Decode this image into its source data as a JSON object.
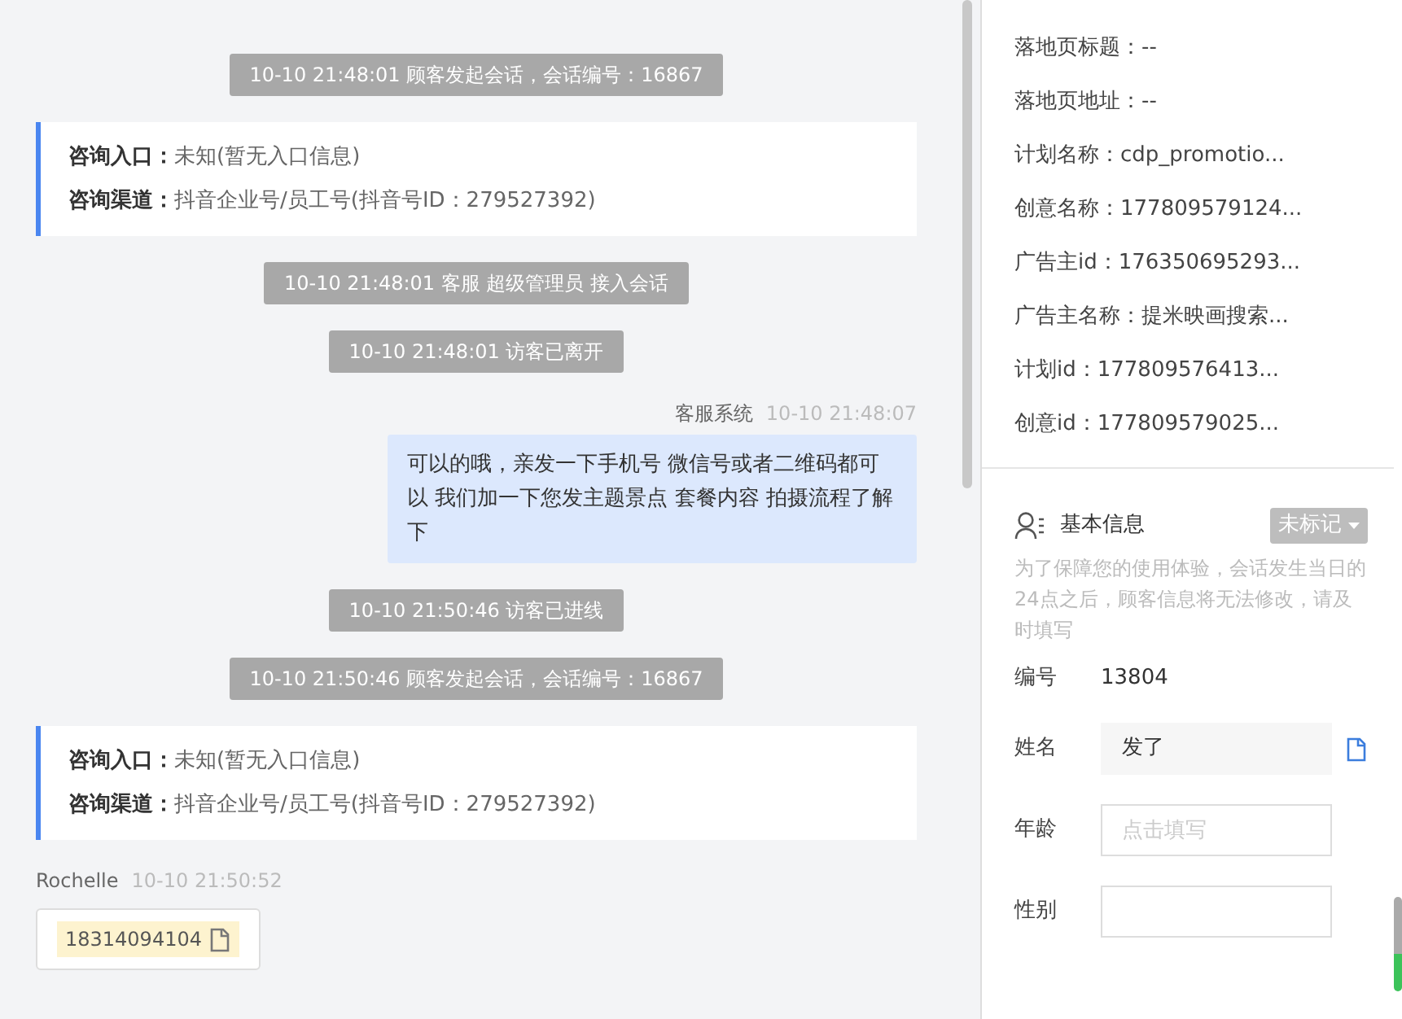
{
  "chat": {
    "messages": [
      {
        "kind": "system",
        "text": "10-10 21:48:01 顾客发起会话，会话编号：16867"
      },
      {
        "kind": "entry",
        "lines": [
          {
            "label": "咨询入口：",
            "value": "未知(暂无入口信息)"
          },
          {
            "label": "咨询渠道：",
            "value": "抖音企业号/员工号(抖音号ID：279527392)"
          }
        ]
      },
      {
        "kind": "system",
        "text": "10-10 21:48:01 客服 超级管理员 接入会话"
      },
      {
        "kind": "system",
        "text": "10-10 21:48:01 访客已离开"
      },
      {
        "kind": "agent",
        "sender": "客服系统",
        "time": "10-10 21:48:07",
        "text": "可以的哦，亲发一下手机号 微信号或者二维码都可以 我们加一下您发主题景点 套餐内容 拍摄流程了解下"
      },
      {
        "kind": "system",
        "text": "10-10 21:50:46 访客已进线"
      },
      {
        "kind": "system",
        "text": "10-10 21:50:46 顾客发起会话，会话编号：16867"
      },
      {
        "kind": "entry",
        "lines": [
          {
            "label": "咨询入口：",
            "value": "未知(暂无入口信息)"
          },
          {
            "label": "咨询渠道：",
            "value": "抖音企业号/员工号(抖音号ID：279527392)"
          }
        ]
      },
      {
        "kind": "visitor",
        "sender": "Rochelle",
        "time": "10-10 21:50:52",
        "phone": "18314094104"
      }
    ]
  },
  "side_panel": {
    "source_details": [
      "落地页标题：--",
      "落地页地址：--",
      "计划名称：cdp_promotio...",
      "创意名称：177809579124...",
      "广告主id：176350695293...",
      "广告主名称：提米映画搜索...",
      "计划id：177809576413...",
      "创意id：177809579025..."
    ],
    "basic_info": {
      "title": "基本信息",
      "tag": "未标记",
      "note": "为了保障您的使用体验，会话发生当日的24点之后，顾客信息将无法修改，请及时填写",
      "fields": [
        {
          "kind": "text",
          "label": "编号",
          "value": "13804"
        },
        {
          "kind": "readonly",
          "label": "姓名",
          "value": "发了"
        },
        {
          "kind": "input",
          "label": "年龄",
          "placeholder": "点击填写"
        },
        {
          "kind": "input",
          "label": "性别"
        }
      ]
    }
  }
}
